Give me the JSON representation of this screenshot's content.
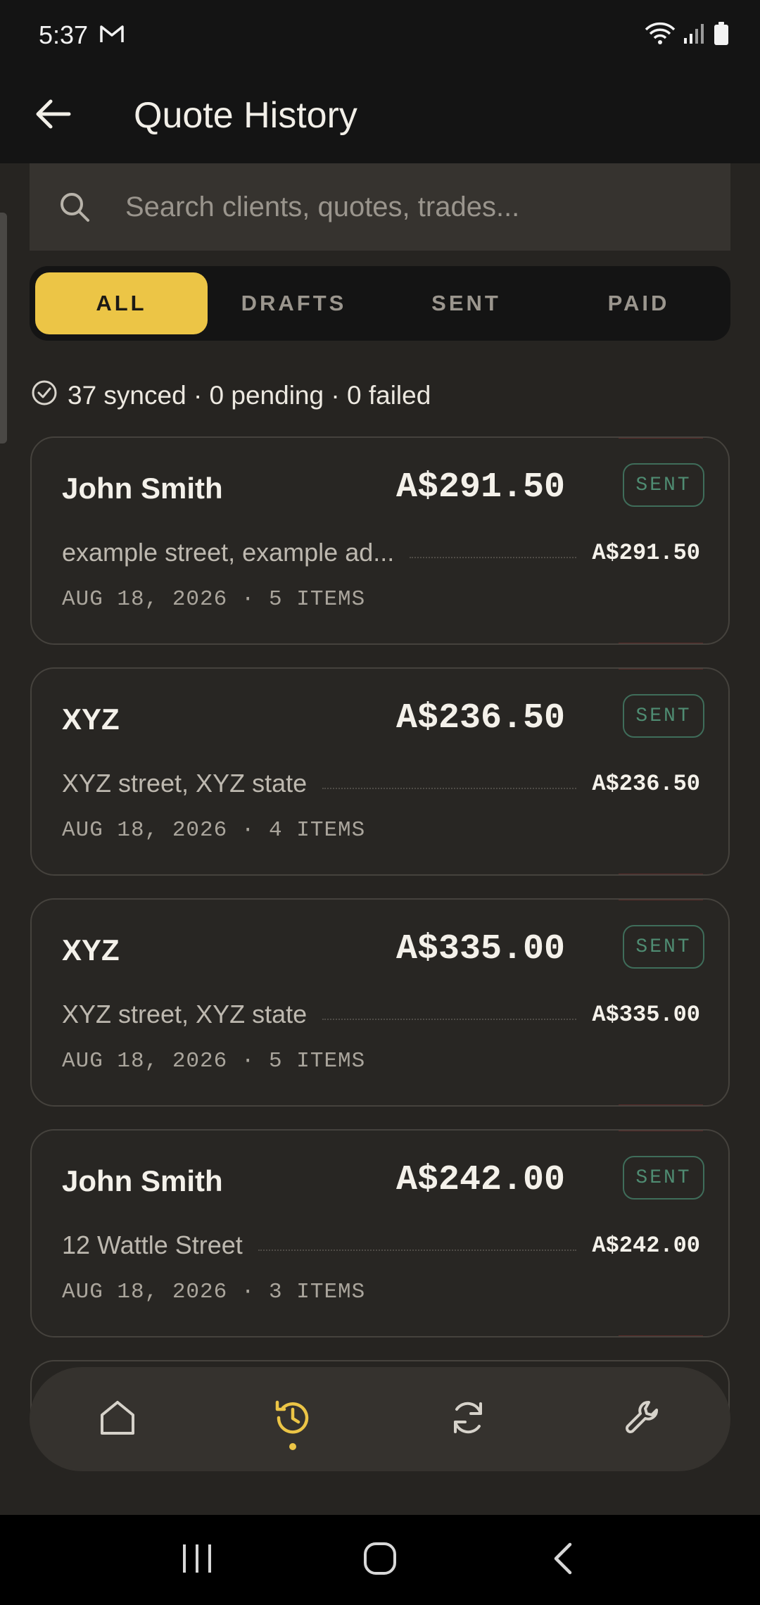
{
  "status_bar": {
    "time": "5:37"
  },
  "header": {
    "title": "Quote History"
  },
  "search": {
    "placeholder": "Search clients, quotes, trades..."
  },
  "tabs": [
    {
      "label": "ALL",
      "active": true
    },
    {
      "label": "DRAFTS",
      "active": false
    },
    {
      "label": "SENT",
      "active": false
    },
    {
      "label": "PAID",
      "active": false
    }
  ],
  "sync": {
    "text": "37 synced · 0 pending · 0 failed"
  },
  "quotes": [
    {
      "client": "John Smith",
      "total": "A$291.50",
      "status": "SENT",
      "address": "example street, example ad...",
      "amount": "A$291.50",
      "meta": "AUG 18, 2026 · 5 ITEMS"
    },
    {
      "client": "XYZ",
      "total": "A$236.50",
      "status": "SENT",
      "address": "XYZ street, XYZ state",
      "amount": "A$236.50",
      "meta": "AUG 18, 2026 · 4 ITEMS"
    },
    {
      "client": "XYZ",
      "total": "A$335.00",
      "status": "SENT",
      "address": "XYZ street, XYZ state",
      "amount": "A$335.00",
      "meta": "AUG 18, 2026 · 5 ITEMS"
    },
    {
      "client": "John Smith",
      "total": "A$242.00",
      "status": "SENT",
      "address": "12 Wattle Street",
      "amount": "A$242.00",
      "meta": "AUG 18, 2026 · 3 ITEMS"
    }
  ],
  "bottom_nav": [
    {
      "icon": "home-icon",
      "active": false
    },
    {
      "icon": "history-icon",
      "active": true
    },
    {
      "icon": "sync-icon",
      "active": false
    },
    {
      "icon": "wrench-icon",
      "active": false
    }
  ],
  "colors": {
    "accent": "#ecc546",
    "background": "#262421",
    "sent_badge": "#4f8c72"
  }
}
